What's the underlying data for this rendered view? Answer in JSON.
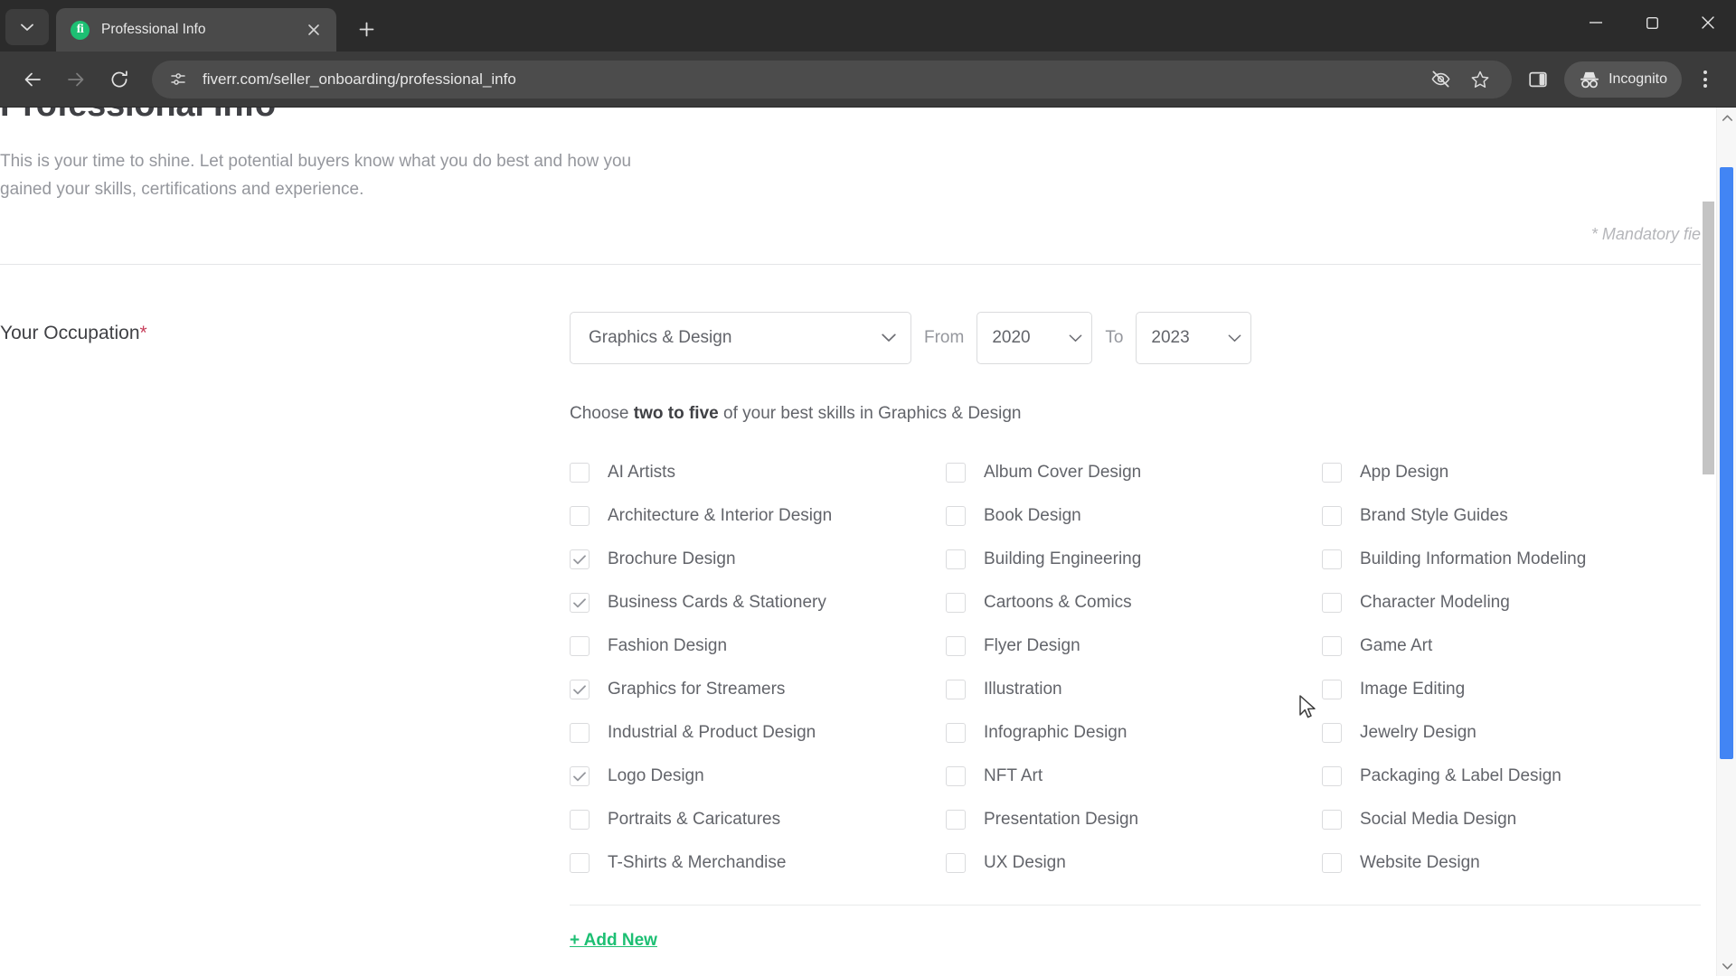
{
  "browser": {
    "tab": {
      "title": "Professional Info",
      "favicon_letters": "fi",
      "favicon_color": "#1dbf73"
    },
    "omnibox": {
      "url": "fiverr.com/seller_onboarding/professional_info"
    },
    "incognito_label": "Incognito",
    "icons": {
      "tab_search": "chevron-down-icon",
      "tab_close": "close-icon",
      "new_tab": "plus-icon",
      "back": "back-arrow-icon",
      "forward": "forward-arrow-icon",
      "reload": "reload-icon",
      "site_info": "page-settings-icon",
      "tracking": "eye-off-icon",
      "bookmark": "star-icon",
      "side_panel": "side-panel-icon",
      "incognito": "incognito-icon",
      "menu": "three-dots-icon",
      "minimize": "minimize-icon",
      "maximize": "maximize-icon",
      "window_close": "window-close-icon"
    }
  },
  "page": {
    "title": "Professional Info",
    "intro": "This is your time to shine. Let potential buyers know what you do best and how you gained your skills, certifications and experience.",
    "mandatory_note": "* Mandatory fields",
    "occupation": {
      "label": "Your Occupation",
      "required_mark": "*",
      "category_value": "Graphics & Design",
      "from_label": "From",
      "from_value": "2020",
      "to_label": "To",
      "to_value": "2023"
    },
    "skills": {
      "instruction_prefix": "Choose ",
      "instruction_strong": "two to five",
      "instruction_suffix": " of your best skills in Graphics & Design",
      "columns": [
        [
          {
            "label": "AI Artists",
            "checked": false
          },
          {
            "label": "Architecture & Interior Design",
            "checked": false
          },
          {
            "label": "Brochure Design",
            "checked": true
          },
          {
            "label": "Business Cards & Stationery",
            "checked": true
          },
          {
            "label": "Fashion Design",
            "checked": false
          },
          {
            "label": "Graphics for Streamers",
            "checked": true
          },
          {
            "label": "Industrial & Product Design",
            "checked": false
          },
          {
            "label": "Logo Design",
            "checked": true
          },
          {
            "label": "Portraits & Caricatures",
            "checked": false
          },
          {
            "label": "T-Shirts & Merchandise",
            "checked": false
          }
        ],
        [
          {
            "label": "Album Cover Design",
            "checked": false
          },
          {
            "label": "Book Design",
            "checked": false
          },
          {
            "label": "Building Engineering",
            "checked": false
          },
          {
            "label": "Cartoons & Comics",
            "checked": false
          },
          {
            "label": "Flyer Design",
            "checked": false
          },
          {
            "label": "Illustration",
            "checked": false
          },
          {
            "label": "Infographic Design",
            "checked": false
          },
          {
            "label": "NFT Art",
            "checked": false
          },
          {
            "label": "Presentation Design",
            "checked": false
          },
          {
            "label": "UX Design",
            "checked": false
          }
        ],
        [
          {
            "label": "App Design",
            "checked": false
          },
          {
            "label": "Brand Style Guides",
            "checked": false
          },
          {
            "label": "Building Information Modeling",
            "checked": false
          },
          {
            "label": "Character Modeling",
            "checked": false
          },
          {
            "label": "Game Art",
            "checked": false
          },
          {
            "label": "Image Editing",
            "checked": false
          },
          {
            "label": "Jewelry Design",
            "checked": false
          },
          {
            "label": "Packaging & Label Design",
            "checked": false
          },
          {
            "label": "Social Media Design",
            "checked": false
          },
          {
            "label": "Website Design",
            "checked": false
          }
        ]
      ]
    },
    "add_new_label": "+ Add New",
    "accent_color": "#1dbf73",
    "required_color": "#c73f5b"
  }
}
